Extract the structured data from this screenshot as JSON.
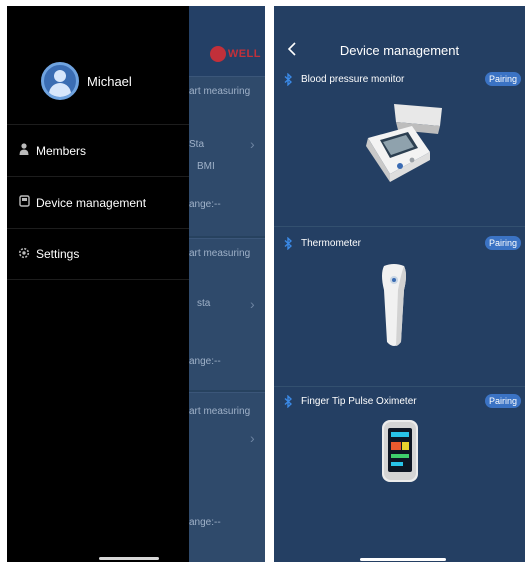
{
  "left_screen": {
    "background": {
      "logo_text": "WELL",
      "rows": [
        {
          "text": "art measuring"
        },
        {
          "text": "Sta"
        },
        {
          "text": "BMI"
        },
        {
          "text": "ange:--"
        },
        {
          "text": "art measuring"
        },
        {
          "text": "sta"
        },
        {
          "text": "ange:--"
        },
        {
          "text": "art measuring"
        },
        {
          "text": "ange:--"
        }
      ]
    },
    "drawer": {
      "profile_name": "Michael",
      "menu": [
        {
          "label": "Members",
          "icon": "person-icon"
        },
        {
          "label": "Device management",
          "icon": "device-icon"
        },
        {
          "label": "Settings",
          "icon": "gear-icon"
        }
      ]
    }
  },
  "right_screen": {
    "title": "Device management",
    "back_icon": "chevron-left-icon",
    "devices": [
      {
        "name": "Blood pressure monitor",
        "action": "Pairing",
        "icon": "bluetooth-icon",
        "image": "blood-pressure-monitor-illustration"
      },
      {
        "name": "Thermometer",
        "action": "Pairing",
        "icon": "bluetooth-icon",
        "image": "thermometer-illustration"
      },
      {
        "name": "Finger Tip Pulse Oximeter",
        "action": "Pairing",
        "icon": "bluetooth-icon",
        "image": "pulse-oximeter-illustration"
      }
    ]
  },
  "colors": {
    "drawer_bg": "#000000",
    "app_bg": "#243f63",
    "accent": "#3b73c4",
    "bluetooth": "#3a89e6",
    "brand_red": "#c2303a"
  }
}
